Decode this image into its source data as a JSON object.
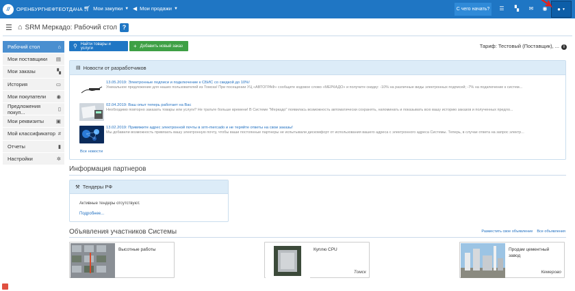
{
  "topbar": {
    "brand_name": "ОРЕНБУРГНЕФТЕОТДАЧА",
    "brand_logo_text": "//",
    "nav": [
      {
        "label": "Мои закупки",
        "icon": "cart-icon"
      },
      {
        "label": "Мои продажи",
        "icon": "megaphone-icon"
      }
    ],
    "help_label": "С чего начать?",
    "icons": [
      "list-icon",
      "cart-icon",
      "envelope-icon",
      "chat-icon",
      "user-icon"
    ],
    "colors": {
      "bar": "#1f76c4",
      "user_button": "#0d5ea8"
    }
  },
  "header": {
    "title": "SRM Меркадо: Рабочий стол",
    "help_badge": "?"
  },
  "sidebar": {
    "items": [
      {
        "label": "Рабочий стол",
        "icon": "home-icon",
        "active": true
      },
      {
        "label": "Мои поставщики",
        "icon": "document-icon"
      },
      {
        "label": "Мои заказы",
        "icon": "cart-icon"
      },
      {
        "label": "История",
        "icon": "inbox-icon"
      },
      {
        "label": "Мои покупатели",
        "icon": "eye-icon"
      },
      {
        "label": "Предложения покуп...",
        "icon": "file-icon"
      },
      {
        "label": "Мои реквизиты",
        "icon": "id-card-icon"
      },
      {
        "label": "Мой классификатор",
        "icon": "hash-icon"
      },
      {
        "label": "Отчеты",
        "icon": "report-icon"
      },
      {
        "label": "Настройки",
        "icon": "gears-icon"
      }
    ]
  },
  "actions": {
    "find_label": "Найти товары и услуги",
    "add_label": "Добавить новый заказ",
    "tariff": "Тариф: Тестовый (Поставщик), ..."
  },
  "news": {
    "title": "Новости от разработчиков",
    "items": [
      {
        "title": "13.05.2019: Электронные подписи и подключение к СБИС со скидкой до 10%!",
        "text": "Уникальное предложение для наших пользователей из Томска! При посещении УЦ «АВТОГРАФ» сообщите кодовое слово «МЕРКАДО» и получите скидку: -10% на различные виды электронных подписей; -7% на подключение к систем..."
      },
      {
        "title": "02.04.2019: Ваш опыт теперь работает на Вас",
        "text": "Необходимо повторно заказать товары или услуги? Не тратьте больше времени! В Системе \"Меркадо\" появилась возможность автоматически сохранять, напоминать и показывать всю вашу историю заказов и полученных предло..."
      },
      {
        "title": "13.02.2019: Привяжите адрес электронной почты в srm-mercado и не теряйте ответы на свои заказы!",
        "text": "Мы добавили возможность привязать вашу электронную почту, чтобы ваши постоянные партнеры не испытывали дискомфорт от использования вашего адреса с электронного адреса Системы. Теперь, в случае ответа на запрос электр..."
      }
    ],
    "all_label": "Все новости"
  },
  "partners": {
    "title": "Информация партнеров",
    "tender_title": "Тендеры РФ",
    "tender_empty": "Активные тендеры отсутствуют.",
    "tender_more": "Подробнее..."
  },
  "ads": {
    "title": "Объявления участников Системы",
    "place_label": "Разместить свое объявление",
    "all_label": "Все объявления",
    "cards": [
      {
        "title": "Высотные работы",
        "city": ""
      },
      {
        "title": "Куплю CPU",
        "city": "Томск"
      },
      {
        "title": "Продам цементный завод",
        "city": "Кемерово"
      }
    ]
  }
}
